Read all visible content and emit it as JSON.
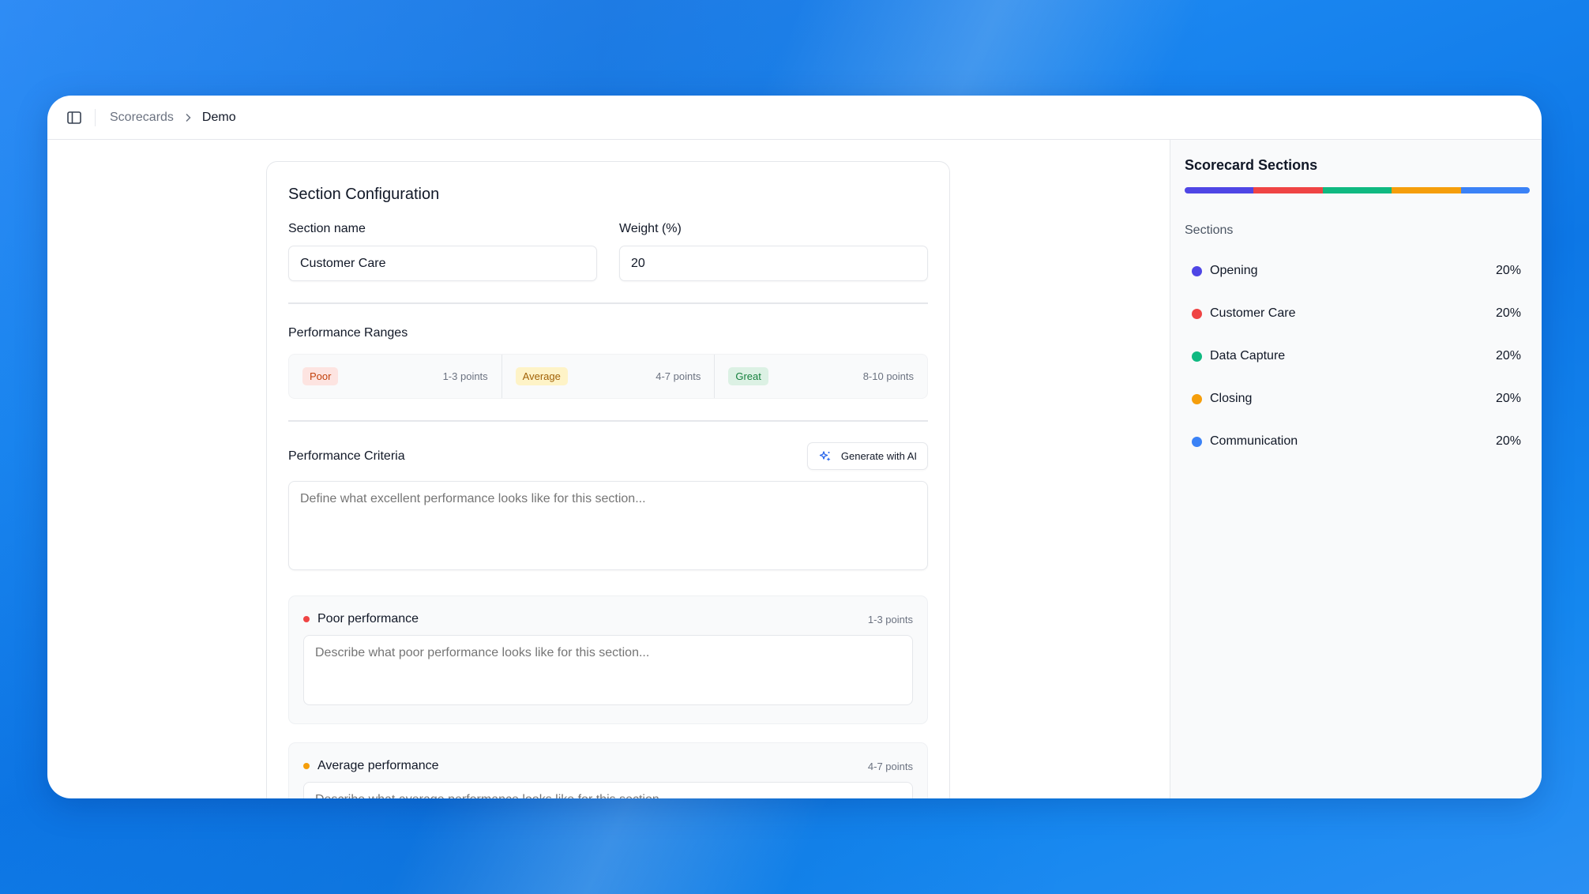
{
  "breadcrumb": {
    "parent": "Scorecards",
    "current": "Demo"
  },
  "config": {
    "title": "Section Configuration",
    "section_name_label": "Section name",
    "section_name_value": "Customer Care",
    "weight_label": "Weight (%)",
    "weight_value": "20",
    "ranges_label": "Performance Ranges",
    "ranges": [
      {
        "label": "Poor",
        "points": "1-3 points"
      },
      {
        "label": "Average",
        "points": "4-7 points"
      },
      {
        "label": "Great",
        "points": "8-10 points"
      }
    ],
    "criteria_label": "Performance Criteria",
    "generate_label": "Generate with AI",
    "criteria_placeholder": "Define what excellent performance looks like for this section...",
    "poor": {
      "title": "Poor performance",
      "points": "1-3 points",
      "placeholder": "Describe what poor performance looks like for this section...",
      "color": "#ef4444"
    },
    "average": {
      "title": "Average performance",
      "points": "4-7 points",
      "placeholder": "Describe what average performance looks like for this section...",
      "color": "#f59e0b"
    }
  },
  "panel": {
    "title": "Scorecard Sections",
    "sections_label": "Sections",
    "sections": [
      {
        "name": "Opening",
        "percent": "20%",
        "weight": 20,
        "color": "#4f46e5"
      },
      {
        "name": "Customer Care",
        "percent": "20%",
        "weight": 20,
        "color": "#ef4444"
      },
      {
        "name": "Data Capture",
        "percent": "20%",
        "weight": 20,
        "color": "#10b981"
      },
      {
        "name": "Closing",
        "percent": "20%",
        "weight": 20,
        "color": "#f59e0b"
      },
      {
        "name": "Communication",
        "percent": "20%",
        "weight": 20,
        "color": "#3b82f6"
      }
    ]
  }
}
